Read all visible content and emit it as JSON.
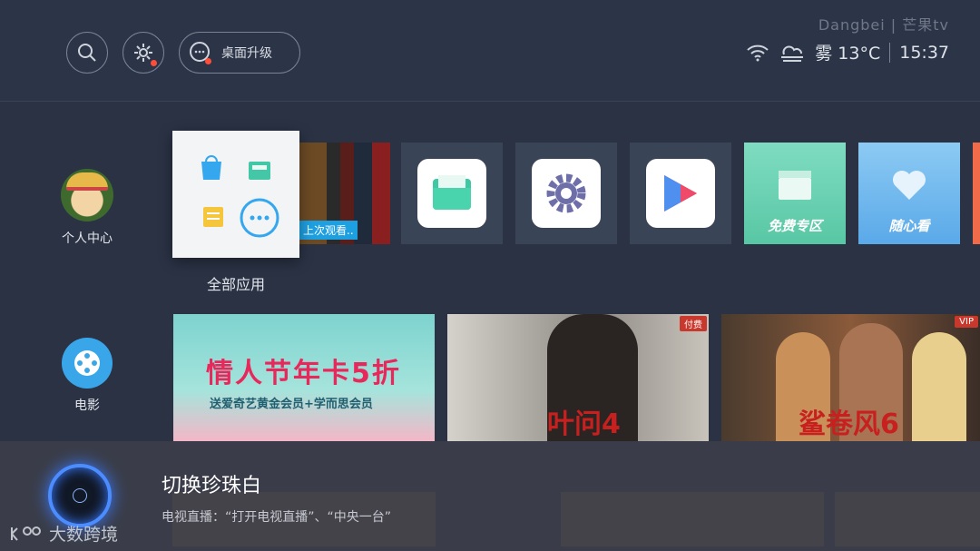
{
  "header": {
    "brand": "Dangbei | 芒果tv",
    "upgrade_label": "桌面升级",
    "weather": "雾 13°C",
    "time": "15:37"
  },
  "sidebar": {
    "profile_label": "个人中心",
    "movie_label": "电影"
  },
  "apps": {
    "all_apps_label": "全部应用",
    "recent_caption": "上次观看..",
    "feature_tiles": [
      {
        "label": "免费专区"
      },
      {
        "label": "随心看"
      }
    ]
  },
  "banners": {
    "promo_title": "情人节年卡5折",
    "promo_subtitle": "送爱奇艺黄金会员+学而思会员",
    "film1_tag": "付费",
    "film1_title": "叶问4",
    "film2_tag": "VIP",
    "film2_title": "鲨卷风6"
  },
  "voice": {
    "title": "切换珍珠白",
    "hint": "电视直播：“打开电视直播”、“中央一台”"
  },
  "watermark": "大数跨境"
}
